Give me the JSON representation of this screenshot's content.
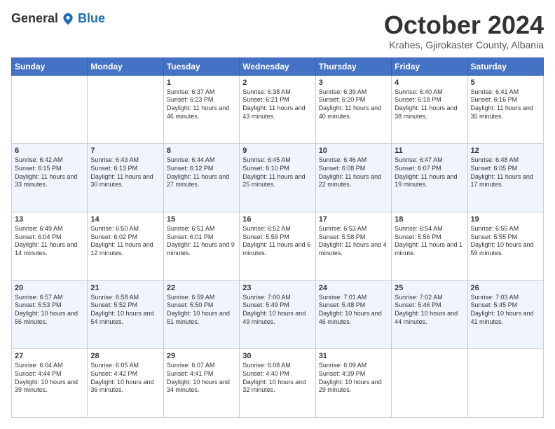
{
  "header": {
    "logo_general": "General",
    "logo_blue": "Blue",
    "month_title": "October 2024",
    "subtitle": "Krahes, Gjirokaster County, Albania"
  },
  "days_of_week": [
    "Sunday",
    "Monday",
    "Tuesday",
    "Wednesday",
    "Thursday",
    "Friday",
    "Saturday"
  ],
  "weeks": [
    [
      {
        "day": "",
        "sunrise": "",
        "sunset": "",
        "daylight": ""
      },
      {
        "day": "",
        "sunrise": "",
        "sunset": "",
        "daylight": ""
      },
      {
        "day": "1",
        "sunrise": "Sunrise: 6:37 AM",
        "sunset": "Sunset: 6:23 PM",
        "daylight": "Daylight: 11 hours and 46 minutes."
      },
      {
        "day": "2",
        "sunrise": "Sunrise: 6:38 AM",
        "sunset": "Sunset: 6:21 PM",
        "daylight": "Daylight: 11 hours and 43 minutes."
      },
      {
        "day": "3",
        "sunrise": "Sunrise: 6:39 AM",
        "sunset": "Sunset: 6:20 PM",
        "daylight": "Daylight: 11 hours and 40 minutes."
      },
      {
        "day": "4",
        "sunrise": "Sunrise: 6:40 AM",
        "sunset": "Sunset: 6:18 PM",
        "daylight": "Daylight: 11 hours and 38 minutes."
      },
      {
        "day": "5",
        "sunrise": "Sunrise: 6:41 AM",
        "sunset": "Sunset: 6:16 PM",
        "daylight": "Daylight: 11 hours and 35 minutes."
      }
    ],
    [
      {
        "day": "6",
        "sunrise": "Sunrise: 6:42 AM",
        "sunset": "Sunset: 6:15 PM",
        "daylight": "Daylight: 11 hours and 33 minutes."
      },
      {
        "day": "7",
        "sunrise": "Sunrise: 6:43 AM",
        "sunset": "Sunset: 6:13 PM",
        "daylight": "Daylight: 11 hours and 30 minutes."
      },
      {
        "day": "8",
        "sunrise": "Sunrise: 6:44 AM",
        "sunset": "Sunset: 6:12 PM",
        "daylight": "Daylight: 11 hours and 27 minutes."
      },
      {
        "day": "9",
        "sunrise": "Sunrise: 6:45 AM",
        "sunset": "Sunset: 6:10 PM",
        "daylight": "Daylight: 11 hours and 25 minutes."
      },
      {
        "day": "10",
        "sunrise": "Sunrise: 6:46 AM",
        "sunset": "Sunset: 6:08 PM",
        "daylight": "Daylight: 11 hours and 22 minutes."
      },
      {
        "day": "11",
        "sunrise": "Sunrise: 6:47 AM",
        "sunset": "Sunset: 6:07 PM",
        "daylight": "Daylight: 11 hours and 19 minutes."
      },
      {
        "day": "12",
        "sunrise": "Sunrise: 6:48 AM",
        "sunset": "Sunset: 6:05 PM",
        "daylight": "Daylight: 11 hours and 17 minutes."
      }
    ],
    [
      {
        "day": "13",
        "sunrise": "Sunrise: 6:49 AM",
        "sunset": "Sunset: 6:04 PM",
        "daylight": "Daylight: 11 hours and 14 minutes."
      },
      {
        "day": "14",
        "sunrise": "Sunrise: 6:50 AM",
        "sunset": "Sunset: 6:02 PM",
        "daylight": "Daylight: 11 hours and 12 minutes."
      },
      {
        "day": "15",
        "sunrise": "Sunrise: 6:51 AM",
        "sunset": "Sunset: 6:01 PM",
        "daylight": "Daylight: 11 hours and 9 minutes."
      },
      {
        "day": "16",
        "sunrise": "Sunrise: 6:52 AM",
        "sunset": "Sunset: 5:59 PM",
        "daylight": "Daylight: 11 hours and 6 minutes."
      },
      {
        "day": "17",
        "sunrise": "Sunrise: 6:53 AM",
        "sunset": "Sunset: 5:58 PM",
        "daylight": "Daylight: 11 hours and 4 minutes."
      },
      {
        "day": "18",
        "sunrise": "Sunrise: 6:54 AM",
        "sunset": "Sunset: 5:56 PM",
        "daylight": "Daylight: 11 hours and 1 minute."
      },
      {
        "day": "19",
        "sunrise": "Sunrise: 6:55 AM",
        "sunset": "Sunset: 5:55 PM",
        "daylight": "Daylight: 10 hours and 59 minutes."
      }
    ],
    [
      {
        "day": "20",
        "sunrise": "Sunrise: 6:57 AM",
        "sunset": "Sunset: 5:53 PM",
        "daylight": "Daylight: 10 hours and 56 minutes."
      },
      {
        "day": "21",
        "sunrise": "Sunrise: 6:58 AM",
        "sunset": "Sunset: 5:52 PM",
        "daylight": "Daylight: 10 hours and 54 minutes."
      },
      {
        "day": "22",
        "sunrise": "Sunrise: 6:59 AM",
        "sunset": "Sunset: 5:50 PM",
        "daylight": "Daylight: 10 hours and 51 minutes."
      },
      {
        "day": "23",
        "sunrise": "Sunrise: 7:00 AM",
        "sunset": "Sunset: 5:49 PM",
        "daylight": "Daylight: 10 hours and 49 minutes."
      },
      {
        "day": "24",
        "sunrise": "Sunrise: 7:01 AM",
        "sunset": "Sunset: 5:48 PM",
        "daylight": "Daylight: 10 hours and 46 minutes."
      },
      {
        "day": "25",
        "sunrise": "Sunrise: 7:02 AM",
        "sunset": "Sunset: 5:46 PM",
        "daylight": "Daylight: 10 hours and 44 minutes."
      },
      {
        "day": "26",
        "sunrise": "Sunrise: 7:03 AM",
        "sunset": "Sunset: 5:45 PM",
        "daylight": "Daylight: 10 hours and 41 minutes."
      }
    ],
    [
      {
        "day": "27",
        "sunrise": "Sunrise: 6:04 AM",
        "sunset": "Sunset: 4:44 PM",
        "daylight": "Daylight: 10 hours and 39 minutes."
      },
      {
        "day": "28",
        "sunrise": "Sunrise: 6:05 AM",
        "sunset": "Sunset: 4:42 PM",
        "daylight": "Daylight: 10 hours and 36 minutes."
      },
      {
        "day": "29",
        "sunrise": "Sunrise: 6:07 AM",
        "sunset": "Sunset: 4:41 PM",
        "daylight": "Daylight: 10 hours and 34 minutes."
      },
      {
        "day": "30",
        "sunrise": "Sunrise: 6:08 AM",
        "sunset": "Sunset: 4:40 PM",
        "daylight": "Daylight: 10 hours and 32 minutes."
      },
      {
        "day": "31",
        "sunrise": "Sunrise: 6:09 AM",
        "sunset": "Sunset: 4:39 PM",
        "daylight": "Daylight: 10 hours and 29 minutes."
      },
      {
        "day": "",
        "sunrise": "",
        "sunset": "",
        "daylight": ""
      },
      {
        "day": "",
        "sunrise": "",
        "sunset": "",
        "daylight": ""
      }
    ]
  ]
}
